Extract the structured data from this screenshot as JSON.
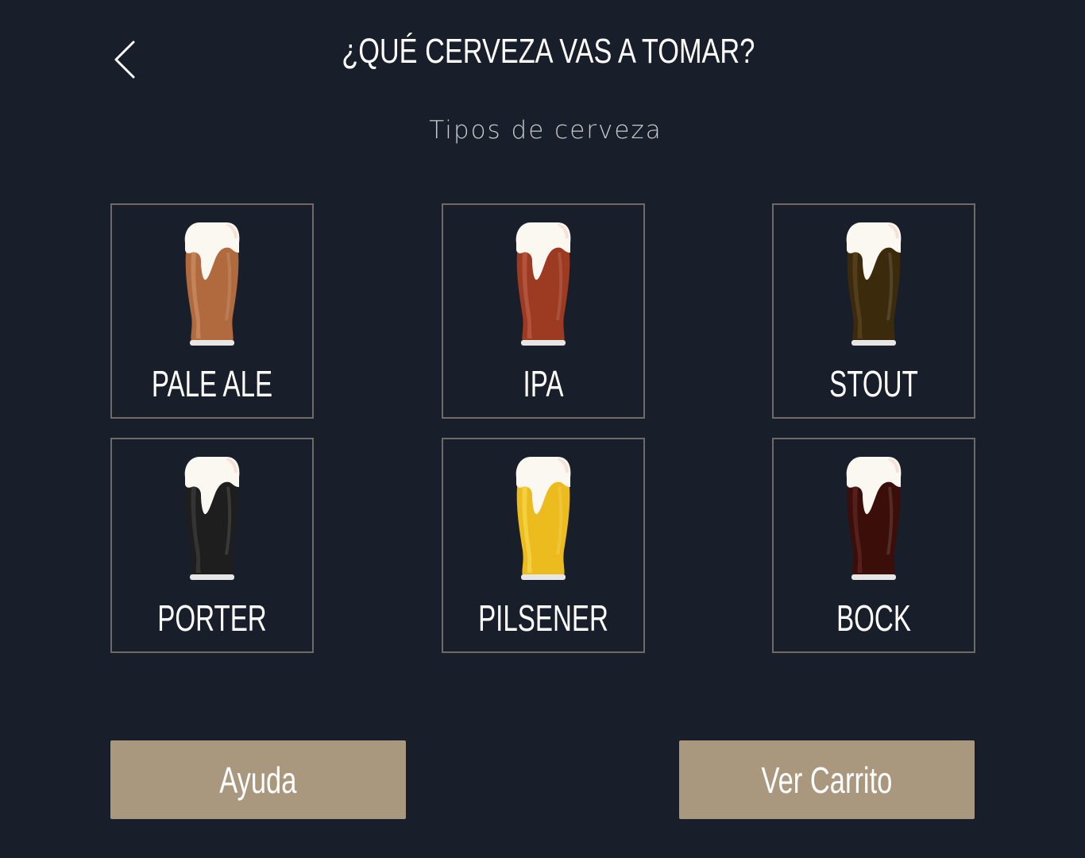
{
  "header": {
    "back_icon": "chevron-left-icon",
    "title": "¿QUÉ CERVEZA VAS A TOMAR?",
    "subtitle": "Tipos de cerveza"
  },
  "beers": [
    {
      "label": "PALE ALE",
      "color": "#b06a3e",
      "highlight": "#c98b62"
    },
    {
      "label": "IPA",
      "color": "#9c3a22",
      "highlight": "#b85a44"
    },
    {
      "label": "STOUT",
      "color": "#3b2a0c",
      "highlight": "#5a4420"
    },
    {
      "label": "PORTER",
      "color": "#1e1e1e",
      "highlight": "#3a3a3a"
    },
    {
      "label": "PILSENER",
      "color": "#ecbc1e",
      "highlight": "#f6d54a"
    },
    {
      "label": "BOCK",
      "color": "#3c0e0a",
      "highlight": "#5a2420"
    }
  ],
  "footer": {
    "help_label": "Ayuda",
    "cart_label": "Ver Carrito"
  },
  "colors": {
    "background": "#181e2a",
    "card_border": "#6d6a68",
    "button": "#a9977e",
    "foam": "#fbf7f1"
  }
}
